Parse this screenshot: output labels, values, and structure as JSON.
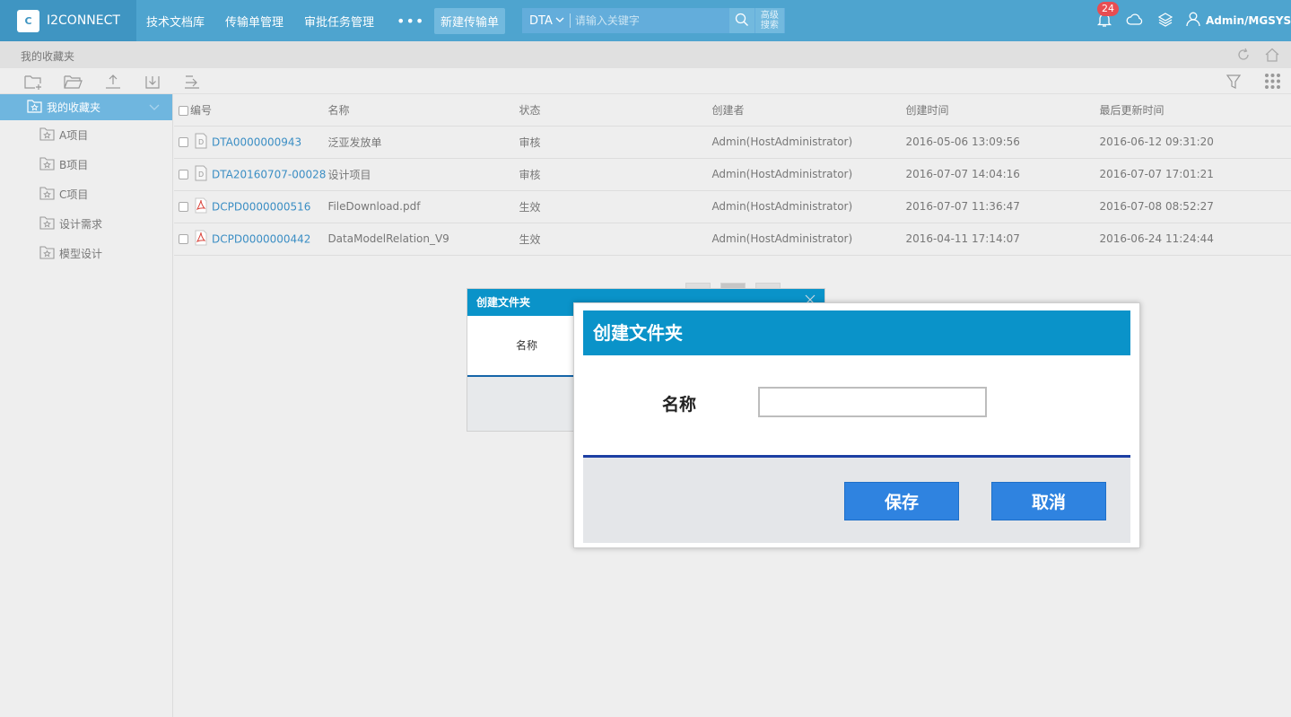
{
  "app": {
    "logo_mark": "C",
    "name": "I2CONNECT"
  },
  "nav": {
    "items": [
      "技术文档库",
      "传输单管理",
      "审批任务管理"
    ],
    "more": "•••",
    "new_button": "新建传输单"
  },
  "search": {
    "type": "DTA",
    "placeholder": "请输入关键字",
    "advanced_line1": "高级",
    "advanced_line2": "搜索"
  },
  "header_right": {
    "notification_count": "24",
    "user": "Admin/MGSYS"
  },
  "breadcrumb": {
    "text": "我的收藏夹"
  },
  "sidebar": {
    "root": "我的收藏夹",
    "items": [
      "A项目",
      "B项目",
      "C项目",
      "设计需求",
      "模型设计"
    ]
  },
  "table": {
    "headers": [
      "编号",
      "名称",
      "状态",
      "创建者",
      "创建时间",
      "最后更新时间"
    ],
    "rows": [
      {
        "icon": "doc-icon",
        "id": "DTA0000000943",
        "name": "泛亚发放单",
        "status": "审核",
        "creator": "Admin(HostAdministrator)",
        "created": "2016-05-06 13:09:56",
        "updated": "2016-06-12 09:31:20"
      },
      {
        "icon": "doc-icon",
        "id": "DTA20160707-00028",
        "name": "设计项目",
        "status": "审核",
        "creator": "Admin(HostAdministrator)",
        "created": "2016-07-07 14:04:16",
        "updated": "2016-07-07 17:01:21"
      },
      {
        "icon": "pdf-icon",
        "id": "DCPD0000000516",
        "name": "FileDownload.pdf",
        "status": "生效",
        "creator": "Admin(HostAdministrator)",
        "created": "2016-07-07 11:36:47",
        "updated": "2016-07-08 08:52:27"
      },
      {
        "icon": "pdf-icon",
        "id": "DCPD0000000442",
        "name": "DataModelRelation_V9",
        "status": "生效",
        "creator": "Admin(HostAdministrator)",
        "created": "2016-04-11 17:14:07",
        "updated": "2016-06-24 11:24:44"
      }
    ]
  },
  "dialog_back": {
    "title": "创建文件夹",
    "name_label": "名称"
  },
  "dialog": {
    "title": "创建文件夹",
    "name_label": "名称",
    "name_value": "",
    "save": "保存",
    "cancel": "取消"
  },
  "colors": {
    "topbar": "#4ea4cf",
    "accent": "#0a93c9",
    "link": "#3b8ec4",
    "button": "#2f83e0",
    "badge": "#e84d52"
  }
}
